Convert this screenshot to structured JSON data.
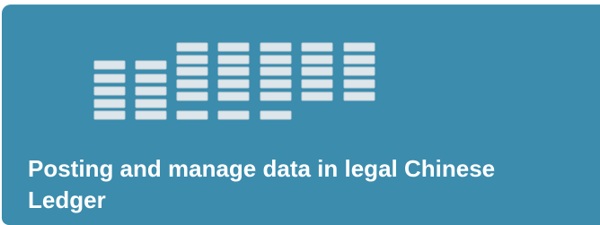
{
  "tile": {
    "title_line1": "Posting and manage data in legal Chinese",
    "title_line2": "Ledger",
    "icon": "ledger-grid-icon",
    "background_color": "#3b8cad",
    "text_color": "#ffffff",
    "cell_color": "#dde6ea"
  }
}
